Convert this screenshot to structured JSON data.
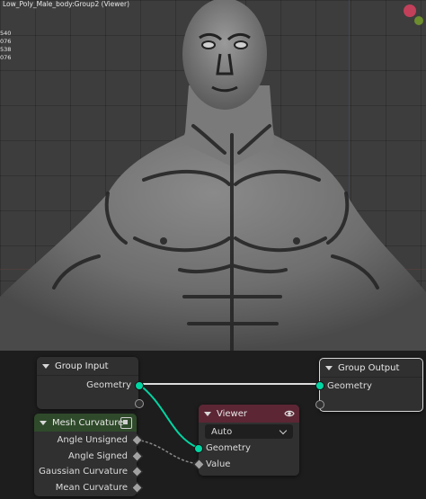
{
  "viewport": {
    "title": "Low_Poly_Male_body:Group2 (Viewer)",
    "stats": [
      "540",
      "076",
      "538",
      "076"
    ]
  },
  "nodes": {
    "group_input": {
      "title": "Group Input",
      "geometry_label": "Geometry"
    },
    "group_output": {
      "title": "Group Output",
      "geometry_label": "Geometry"
    },
    "mesh_curvature": {
      "title": "Mesh Curvature",
      "outputs": [
        "Angle Unsigned",
        "Angle Signed",
        "Gaussian Curvature",
        "Mean Curvature"
      ]
    },
    "viewer": {
      "title": "Viewer",
      "domain_value": "Auto",
      "geometry_label": "Geometry",
      "value_label": "Value"
    }
  },
  "colors": {
    "geometry_socket": "#00d6a3",
    "viewer_header": "#5c2635",
    "field_header": "#2f4a2a"
  },
  "icons": [
    "chevron-down-icon",
    "eye-icon",
    "mesh-data-icon",
    "dropdown-chevron-icon"
  ]
}
